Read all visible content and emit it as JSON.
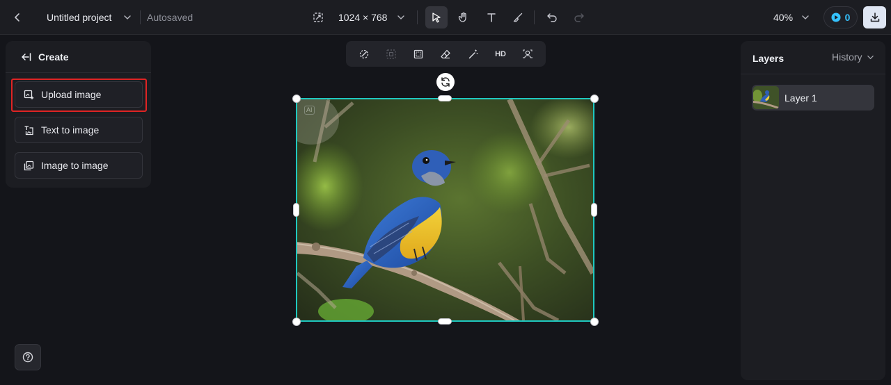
{
  "header": {
    "project_title": "Untitled project",
    "save_status": "Autosaved",
    "canvas_size": "1024 × 768",
    "zoom": "40%",
    "credits": "0"
  },
  "left_panel": {
    "title": "Create",
    "buttons": [
      {
        "label": "Upload image",
        "icon": "upload-image-icon"
      },
      {
        "label": "Text to image",
        "icon": "text-to-image-icon"
      },
      {
        "label": "Image to image",
        "icon": "image-to-image-icon"
      }
    ]
  },
  "floating_toolbar": {
    "hd_label": "HD"
  },
  "canvas": {
    "ai_badge": "AI"
  },
  "right_panel": {
    "layers_label": "Layers",
    "history_label": "History",
    "layers": [
      {
        "name": "Layer 1"
      }
    ]
  },
  "colors": {
    "selection": "#1fc8c0",
    "highlight": "#e02424",
    "credits_accent": "#35c3ff"
  }
}
